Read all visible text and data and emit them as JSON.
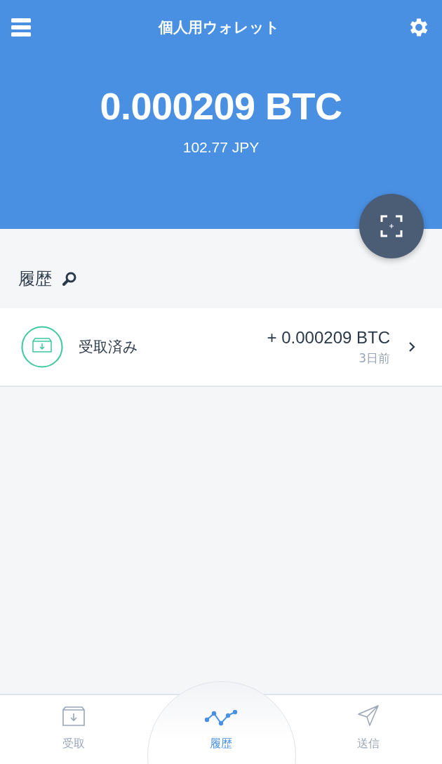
{
  "header": {
    "title": "個人用ウォレット"
  },
  "balance": {
    "amount": "0.000209 BTC",
    "fiat": "102.77 JPY"
  },
  "history": {
    "title": "履歴",
    "items": [
      {
        "kind": "received",
        "label": "受取済み",
        "amount": "+ 0.000209 BTC",
        "time": "3日前"
      }
    ]
  },
  "tabs": [
    {
      "kind": "receive",
      "label": "受取",
      "selected": false
    },
    {
      "kind": "history",
      "label": "履歴",
      "selected": true
    },
    {
      "kind": "send",
      "label": "送信",
      "selected": false
    }
  ]
}
